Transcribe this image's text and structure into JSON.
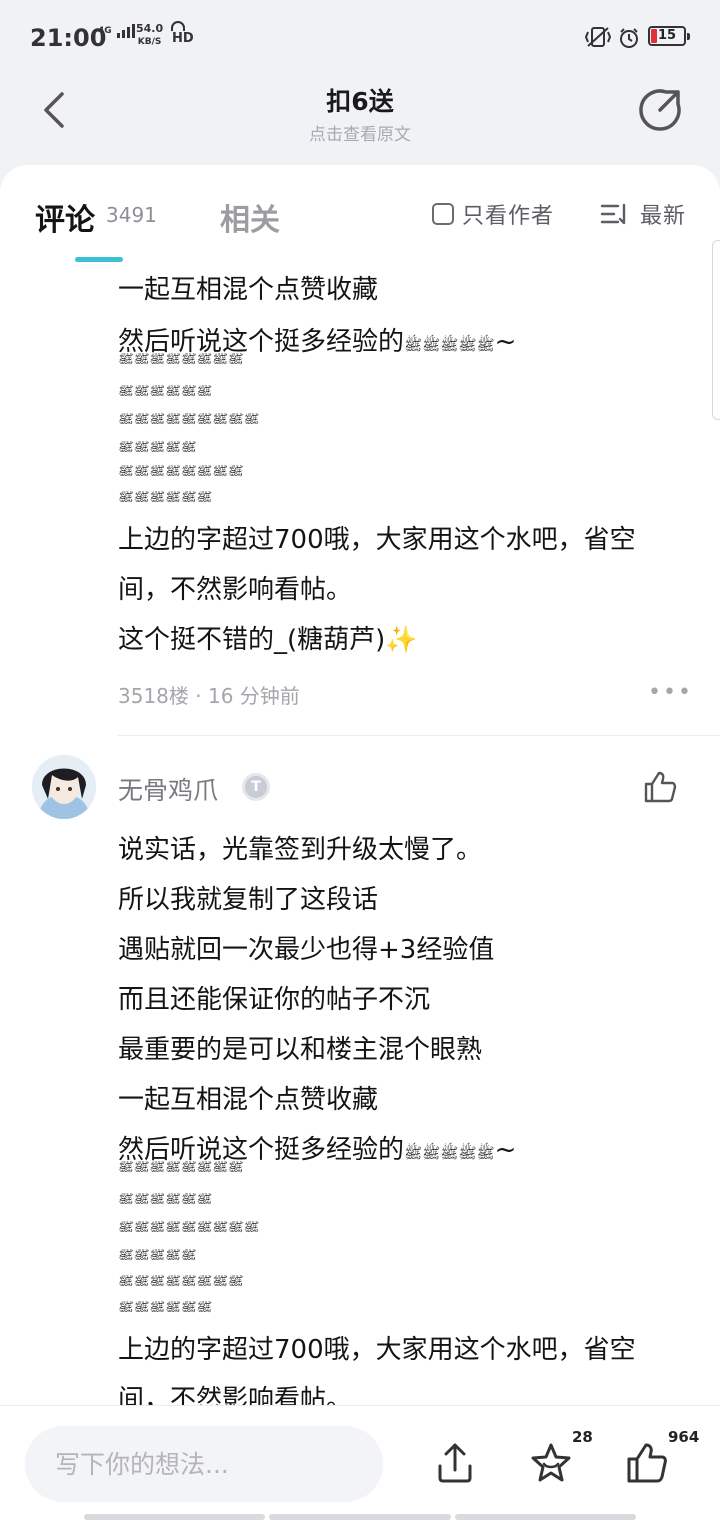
{
  "status_bar": {
    "time": "21:00",
    "network": "4G",
    "speed_value": "54.0",
    "speed_unit": "KB/S",
    "hd": "HD",
    "battery": "15"
  },
  "header": {
    "title": "扣6送",
    "subtitle": "点击查看原文"
  },
  "tabs": {
    "comments_label": "评论",
    "comments_count": "3491",
    "related_label": "相关",
    "only_author": "只看作者",
    "sort": "最新"
  },
  "post_top": {
    "lines": [
      "一起互相混个点赞收藏",
      "然后听说这个挺多经验的",
      "上边的字超过700哦，大家用这个水吧，省空",
      "间，不然影响看帖。",
      "这个挺不错的_(糖葫芦)✨"
    ],
    "tilde": "~",
    "deco_rows": [
      "ﷺﷺﷺﷺﷺﷺﷺﷺ",
      "ﷺﷺﷺﷺﷺﷺ",
      "ﷺﷺﷺﷺﷺﷺﷺﷺﷺ",
      "ﷺﷺﷺﷺﷺ",
      "ﷺﷺﷺﷺﷺﷺﷺﷺ",
      "ﷺﷺﷺﷺﷺﷺ"
    ],
    "meta": "3518楼 · 16 分钟前",
    "more": "•••"
  },
  "post_second": {
    "username": "无骨鸡爪",
    "level": "T",
    "lines": [
      " 说实话，光靠签到升级太慢了。",
      "所以我就复制了这段话",
      "遇贴就回一次最少也得+3经验值",
      "而且还能保证你的帖子不沉",
      "最重要的是可以和楼主混个眼熟",
      "一起互相混个点赞收藏",
      "然后听说这个挺多经验的",
      "上边的字超过700哦，大家用这个水吧，省空",
      "间，不然影响看帖。"
    ]
  },
  "bottom_bar": {
    "placeholder": "写下你的想法...",
    "fav_count": "28",
    "like_count": "964"
  }
}
